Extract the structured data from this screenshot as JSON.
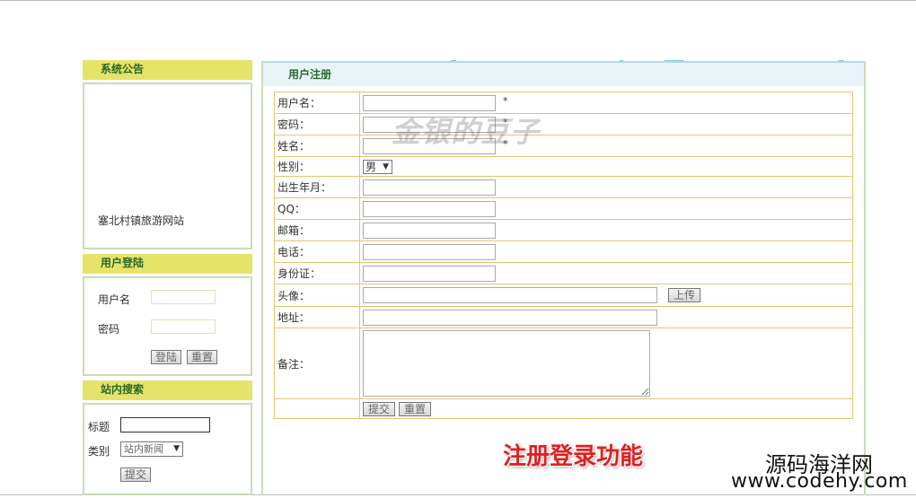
{
  "sidebar": {
    "notice": {
      "title": "系统公告",
      "text": "塞北村镇旅游网站"
    },
    "login": {
      "title": "用户登陆",
      "username_label": "用户名",
      "password_label": "密码",
      "login_button": "登陆",
      "reset_button": "重置"
    },
    "search": {
      "title": "站内搜索",
      "title_label": "标题",
      "category_label": "类别",
      "category_selected": "站内新闻",
      "submit_button": "提交"
    }
  },
  "main": {
    "heading": "用户注册",
    "fields": {
      "username": "用户名：",
      "password": "密码：",
      "name": "姓名：",
      "gender": "性别：",
      "birth": "出生年月：",
      "qq": "QQ：",
      "email": "邮箱：",
      "phone": "电话：",
      "id_card": "身份证：",
      "avatar": "头像：",
      "address": "地址：",
      "remark": "备注："
    },
    "required_mark": "*",
    "gender_selected": "男",
    "upload_button": "上传",
    "submit_button": "提交",
    "reset_button": "重置"
  },
  "overlay": {
    "watermark": "金银的豆子",
    "caption": "注册登录功能",
    "brand_name": "源码海洋网",
    "brand_url": "www.codehy.com"
  },
  "colors": {
    "panel_title_bg": "#e6e36a",
    "panel_border": "#c9dcb4",
    "table_border": "#e2c572",
    "main_head_bg": "#e8f3f8",
    "caption_red": "#e02020"
  }
}
